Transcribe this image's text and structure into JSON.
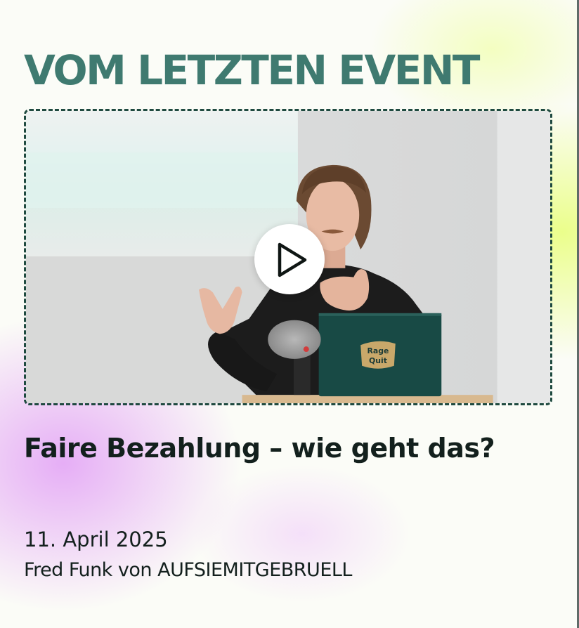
{
  "section": {
    "title": "VOM LETZTEN EVENT"
  },
  "video": {
    "play_icon": "play-icon",
    "laptop_sticker_text": "Rage Quit"
  },
  "event": {
    "title": "Faire Bezahlung – wie geht das?",
    "date": "11. April 2025",
    "speaker": "Fred Funk von AUFSIEMITGEBRUELL"
  },
  "colors": {
    "heading": "#3f7a70",
    "text": "#13201d",
    "frame": "#1f4a40",
    "accent_lime": "#e8ff78",
    "accent_violet": "#e2a0f6"
  }
}
